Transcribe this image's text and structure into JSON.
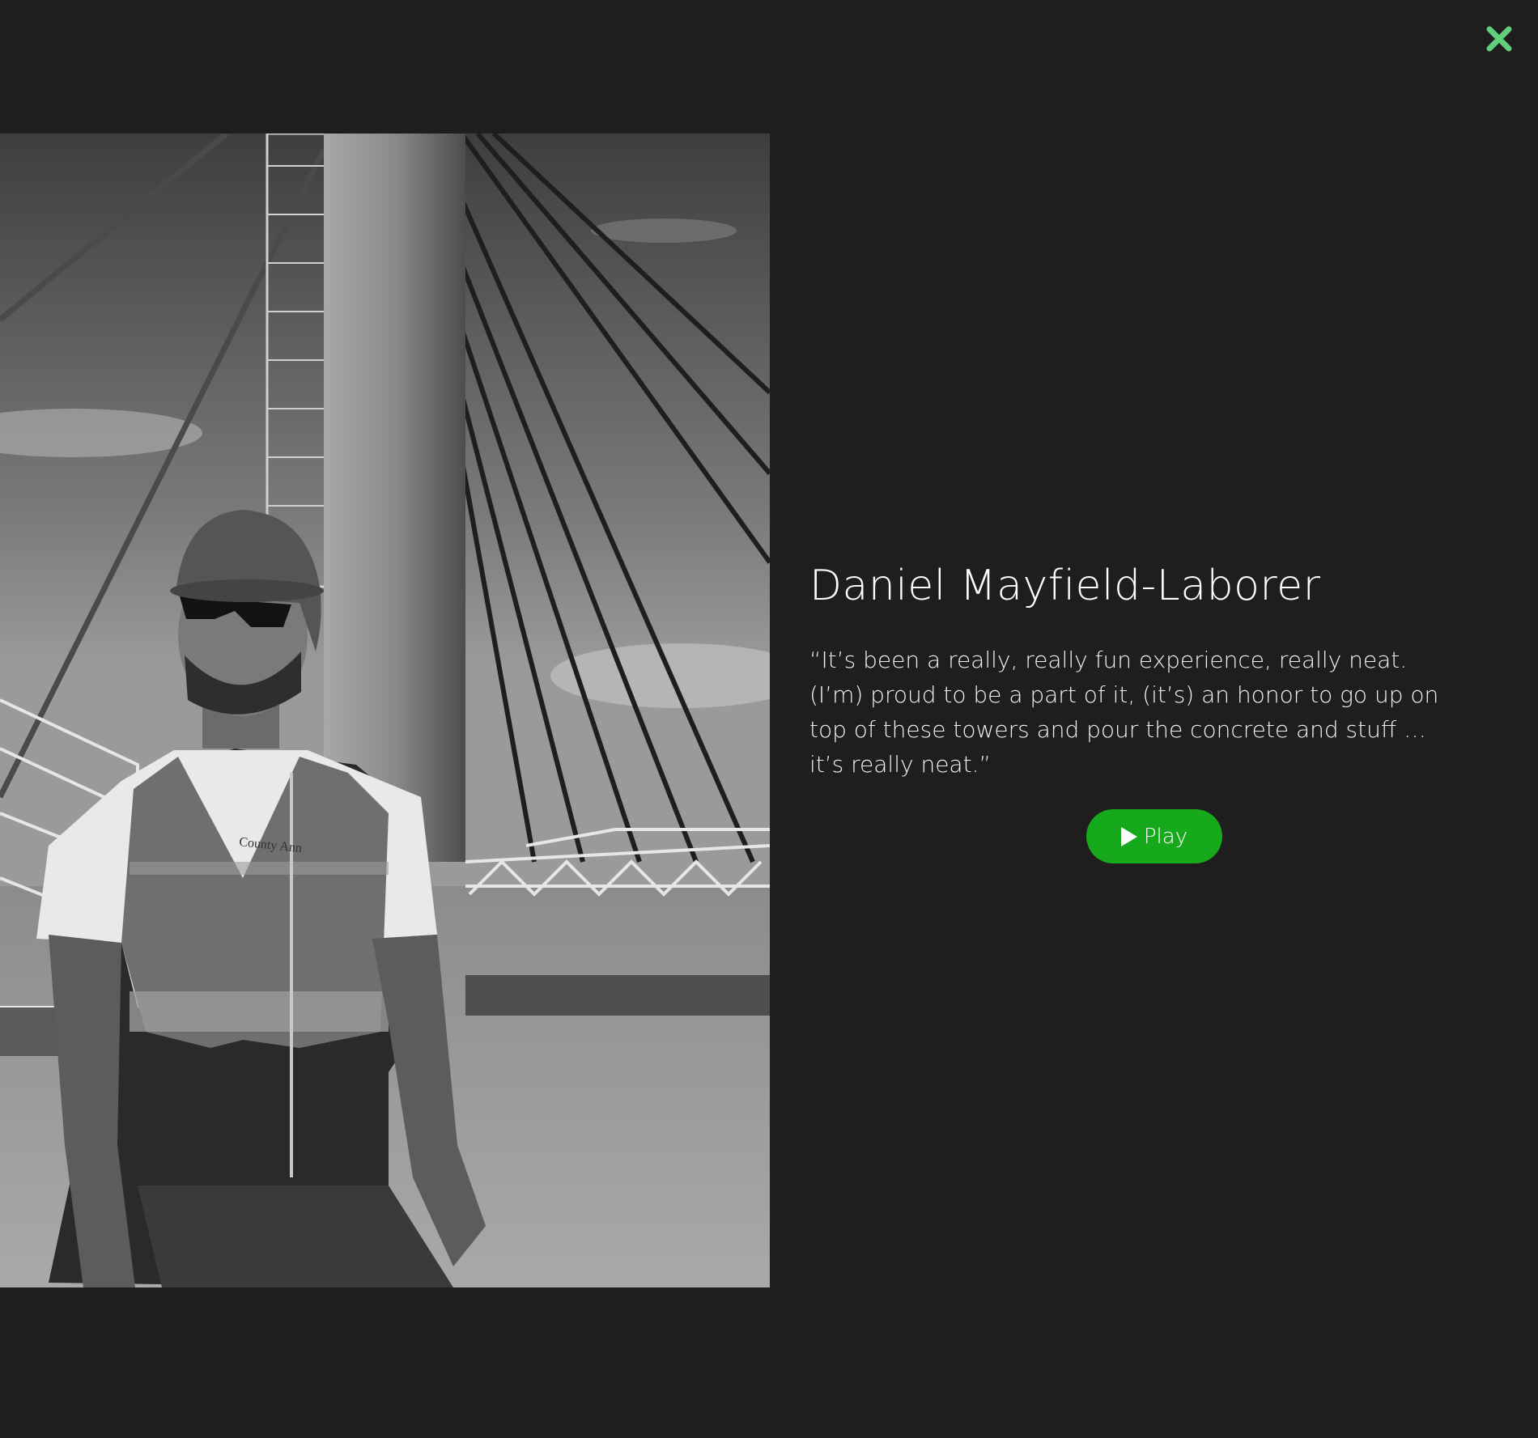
{
  "modal": {
    "close_icon": "close-x-icon",
    "close_color": "#5fcf7a"
  },
  "profile": {
    "name": "Daniel Mayfield-Laborer",
    "quote": "“It’s been a really, really fun experience, really neat. (I’m) proud to be a part of it, (it’s) an honor to go up on top of these towers and pour the concrete and stuff … it’s really neat.”",
    "photo_subject": "black-and-white photo of construction laborer in hard hat and safety vest on bridge deck",
    "photo_shirt_text": "County Ann"
  },
  "player": {
    "play_label": "Play",
    "play_icon": "play-triangle-icon",
    "accent": "#16a91c"
  }
}
